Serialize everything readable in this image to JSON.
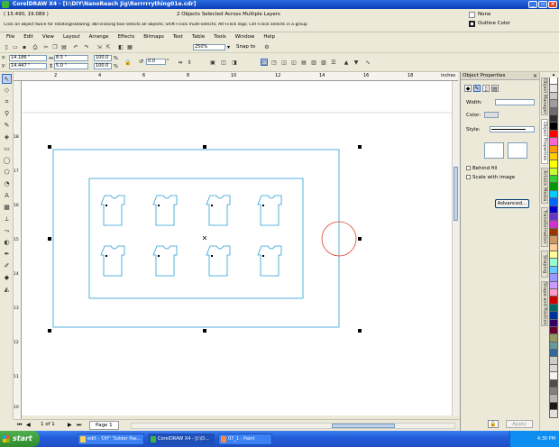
{
  "window": {
    "title": "CorelDRAW X4 - [I:\\DIY\\NanoReach Jig\\Rerrrrrything01e.cdr]"
  },
  "status": {
    "coords": "( 15.490, 19.089 )",
    "selection": "2 Objects Selected Across Multiple Layers",
    "hint": "Click an object twice for rotating/skewing; dbl-clicking tool selects all objects; Shift+click multi-selects; Alt+click digs; Ctrl+click selects in a group",
    "fill_label": "None",
    "outline_label": "Outline Color"
  },
  "menu": [
    "File",
    "Edit",
    "View",
    "Layout",
    "Arrange",
    "Effects",
    "Bitmaps",
    "Text",
    "Table",
    "Tools",
    "Window",
    "Help"
  ],
  "toolbar": {
    "zoom": "250%",
    "snap_label": "Snap to"
  },
  "propbar": {
    "x": "14.186 \"",
    "y": "14.447 \"",
    "width": "8.5 \"",
    "height": "5.0 \"",
    "scale_x": "100.0",
    "scale_y": "100.0",
    "pct": "%",
    "angle": "0.0",
    "deg": "°"
  },
  "ruler": {
    "labels": [
      "2",
      "4",
      "6",
      "8",
      "10",
      "12",
      "14",
      "16",
      "18"
    ],
    "vlabels": [
      "10",
      "11",
      "12",
      "13",
      "14",
      "15",
      "16",
      "17",
      "18"
    ],
    "units": "inches"
  },
  "panel": {
    "title": "Object Properties",
    "width_label": "Width:",
    "color_label": "Color:",
    "style_label": "Style:",
    "behind_fill": "Behind fill",
    "scale_with_image": "Scale with image",
    "advanced": "Advanced...",
    "apply": "Apply"
  },
  "side_tabs": [
    "Object Manager",
    "Object Properties",
    "Artistic Media",
    "Transformation",
    "Shaping",
    "Shape and Position"
  ],
  "pagebar": {
    "page_count": "1 of 1",
    "page_tab": "Page 1"
  },
  "taskbar": {
    "start": "start",
    "tasks": [
      "edit - 'DIY' 'Solder Pas...",
      "CorelDRAW X4 - [I:\\D...",
      "07_1 - Paint"
    ],
    "clock": "4:30 PM"
  },
  "colors": {
    "shape_outline": "#2a9fd6",
    "circle_outline": "#d9462a",
    "title_bar": "#0a3fb8",
    "taskbar": "#245edb"
  },
  "palette": [
    "#ffffff",
    "#e6e6e6",
    "#c8c8c8",
    "#9e9e9e",
    "#6e6e6e",
    "#2f2f2f",
    "#000000",
    "#ff0000",
    "#ff66cc",
    "#ff9900",
    "#ffcc00",
    "#ffff00",
    "#ccff33",
    "#33cc33",
    "#009900",
    "#00ccff",
    "#0066ff",
    "#0000cc",
    "#6633cc",
    "#cc33cc",
    "#993300",
    "#cc9966",
    "#ffcc99",
    "#ffff99",
    "#99ffcc",
    "#66ccff",
    "#9999ff",
    "#cc99ff",
    "#ff99cc",
    "#cc0000",
    "#006666",
    "#003399",
    "#330066",
    "#660033",
    "#999966",
    "#669999",
    "#336699",
    "#cccccc",
    "#d9d9d9",
    "#f2f2f2",
    "#4d4d4d",
    "#808080",
    "#b3b3b3",
    "#1a1a1a",
    "#e0e0e0"
  ]
}
